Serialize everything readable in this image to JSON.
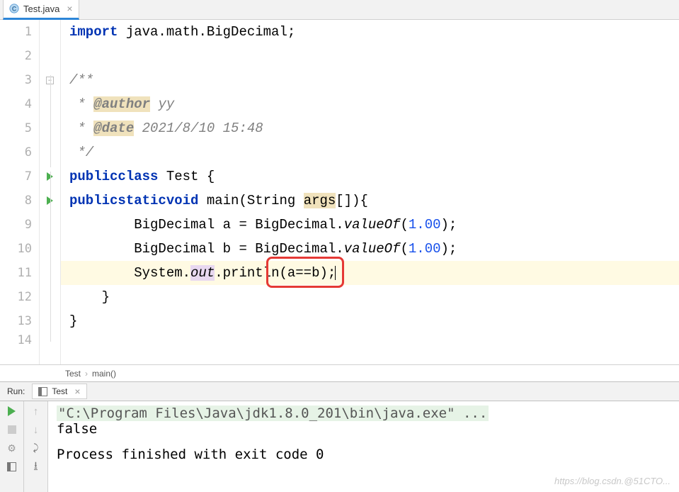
{
  "tab": {
    "filename": "Test.java"
  },
  "code": {
    "l1_import": "import",
    "l1_rest": " java.math.BigDecimal;",
    "l3": "/**",
    "l4_pre": " * ",
    "l4_tag": "@author",
    "l4_post": " yy",
    "l5_pre": " * ",
    "l5_tag": "@date",
    "l5_post": " 2021/8/10 15:48",
    "l6": " */",
    "l7_public": "public",
    "l7_class": "class",
    "l7_rest": " Test {",
    "l8_public": "public",
    "l8_static": "static",
    "l8_void": "void",
    "l8_main": " main(String ",
    "l8_args": "args",
    "l8_tail": "[]){",
    "l9_a": "        BigDecimal a = BigDecimal.",
    "l9_valof": "valueOf",
    "l9_open": "(",
    "l9_num": "1.00",
    "l9_close": ");",
    "l10_a": "        BigDecimal b = BigDecimal.",
    "l10_valof": "valueOf",
    "l10_open": "(",
    "l10_num": "1.00",
    "l10_close": ");",
    "l11_a": "        System.",
    "l11_out": "out",
    "l11_b": ".println(a==b);",
    "l12": "    }",
    "l13": "}"
  },
  "gutter_lines": [
    "1",
    "2",
    "3",
    "4",
    "5",
    "6",
    "7",
    "8",
    "9",
    "10",
    "11",
    "12",
    "13",
    "14"
  ],
  "breadcrumb": {
    "a": "Test",
    "b": "main()"
  },
  "run": {
    "label": "Run:",
    "config": "Test",
    "cmd": "\"C:\\Program Files\\Java\\jdk1.8.0_201\\bin\\java.exe\" ...",
    "out1": "false",
    "exit": "Process finished with exit code 0"
  },
  "watermark": "https://blog.csdn.@51CTO..."
}
